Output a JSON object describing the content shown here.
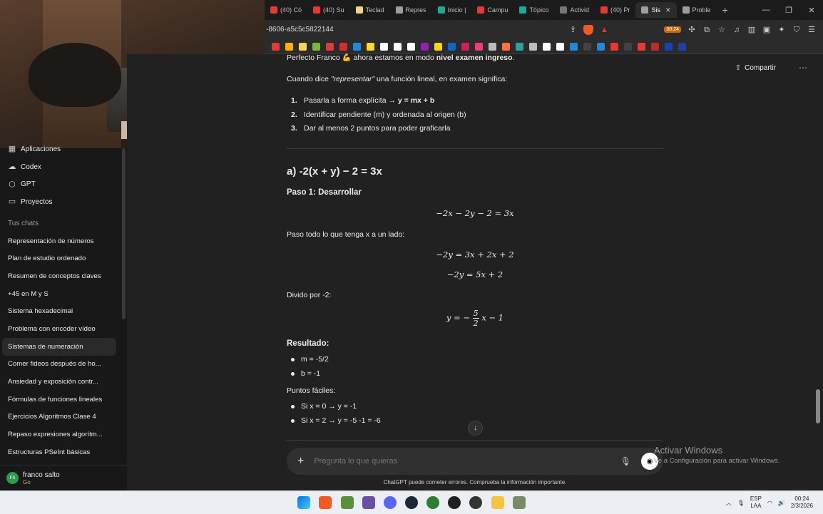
{
  "browser": {
    "tabs": [
      {
        "label": "(40) Có",
        "color": "#e53935"
      },
      {
        "label": "(40) Su",
        "color": "#e53935"
      },
      {
        "label": "Teclad",
        "color": "#f0d48a"
      },
      {
        "label": "Repres",
        "color": "#9e9e9e"
      },
      {
        "label": "Inicio |",
        "color": "#26a69a"
      },
      {
        "label": "Campu",
        "color": "#e53935"
      },
      {
        "label": "Tópico",
        "color": "#26a69a"
      },
      {
        "label": "Activid",
        "color": "#757575"
      },
      {
        "label": "(40) Pr",
        "color": "#e53935"
      },
      {
        "label": "Sis",
        "color": "#9e9e9e",
        "active": true
      },
      {
        "label": "Proble",
        "color": "#9e9e9e"
      }
    ],
    "url": "-8606-a5c5c5822144",
    "badge_time": "00:24",
    "bookmark_colors": [
      "#e53935",
      "#ffb300",
      "#ffd54f",
      "#7cb342",
      "#e53935",
      "#d32f2f",
      "#1e88e5",
      "#fdd835",
      "#fff",
      "#fff",
      "#fff",
      "#8e24aa",
      "#ffd600",
      "#1565c0",
      "#d81b60",
      "#ec407a",
      "#bdbdbd",
      "#ff7043",
      "#26a69a",
      "#bdbdbd",
      "#fff",
      "#fff",
      "#1e88e5",
      "#424242",
      "#1e88e5",
      "#e53935",
      "#424242",
      "#e53935",
      "#c62828",
      "#1e40af",
      "#1e40af"
    ]
  },
  "sidebar": {
    "top_items": [
      {
        "label": "Aplicaciones",
        "icon": "apps-icon"
      },
      {
        "label": "Codex",
        "icon": "codex-icon"
      },
      {
        "label": "GPT",
        "icon": "gpt-icon"
      },
      {
        "label": "Proyectos",
        "icon": "folder-icon"
      }
    ],
    "section_title": "Tus chats",
    "chats": [
      "Representación de números",
      "Plan de estudio ordenado",
      "Resumen de conceptos claves",
      "+45 en M y S",
      "Sistema hexadecimal",
      "Problema con encoder vídeo",
      "Sistemas de numeración",
      "Comer fideos después de ho...",
      "Ansiedad y exposición contr...",
      "Fórmulas de funciones lineales",
      "Ejercicios Algoritmos Clase 4",
      "Repaso expresiones algorítm...",
      "Estructuras PSeInt básicas"
    ],
    "active_chat_index": 6,
    "user": {
      "initials": "FS",
      "name": "franco salto",
      "plan": "Go"
    }
  },
  "main": {
    "share_label": "Compartir",
    "intro_prefix": "Perfecto Franco 💪 ahora estamos en modo ",
    "intro_bold": "nivel examen ingreso",
    "intro_suffix": ".",
    "definition_prefix": "Cuando dice ",
    "definition_italic": "\"representar\"",
    "definition_suffix": " una función lineal, en examen significa:",
    "steps": [
      {
        "n": "1.",
        "text": "Pasarla a forma explícita → ",
        "bold": "y = mx + b"
      },
      {
        "n": "2.",
        "text": "Identificar pendiente (m) y ordenada al origen (b)",
        "bold": ""
      },
      {
        "n": "3.",
        "text": "Dar al menos 2 puntos para poder graficarla",
        "bold": ""
      }
    ],
    "exercise_title": "a) -2(x + y) − 2 = 3x",
    "step1_title": "Paso 1: Desarrollar",
    "eq1": "−2x − 2y − 2 = 3x",
    "move_text": "Paso todo lo que tenga x a un lado:",
    "eq2": "−2y = 3x + 2x + 2",
    "eq3": "−2y = 5x + 2",
    "divide_text": "Divido por -2:",
    "eq4_left": "y = −",
    "eq4_num": "5",
    "eq4_den": "2",
    "eq4_right": "x − 1",
    "result_title": "Resultado:",
    "results": [
      "m = -5/2",
      "b = -1"
    ],
    "points_title": "Puntos fáciles:",
    "points": [
      "Si x = 0 → y = -1",
      "Si x = 2 → y = -5 -1 = -6"
    ],
    "composer_placeholder": "Pregunta lo que quieras",
    "disclaimer": "ChatGPT puede cometer errores. Comprueba la información importante.",
    "activate_title": "Activar Windows",
    "activate_sub": "Ve a Configuración para activar Windows."
  },
  "taskbar": {
    "lang_top": "ESP",
    "lang_bottom": "LAA",
    "time": "00:24",
    "date": "2/3/2026"
  }
}
